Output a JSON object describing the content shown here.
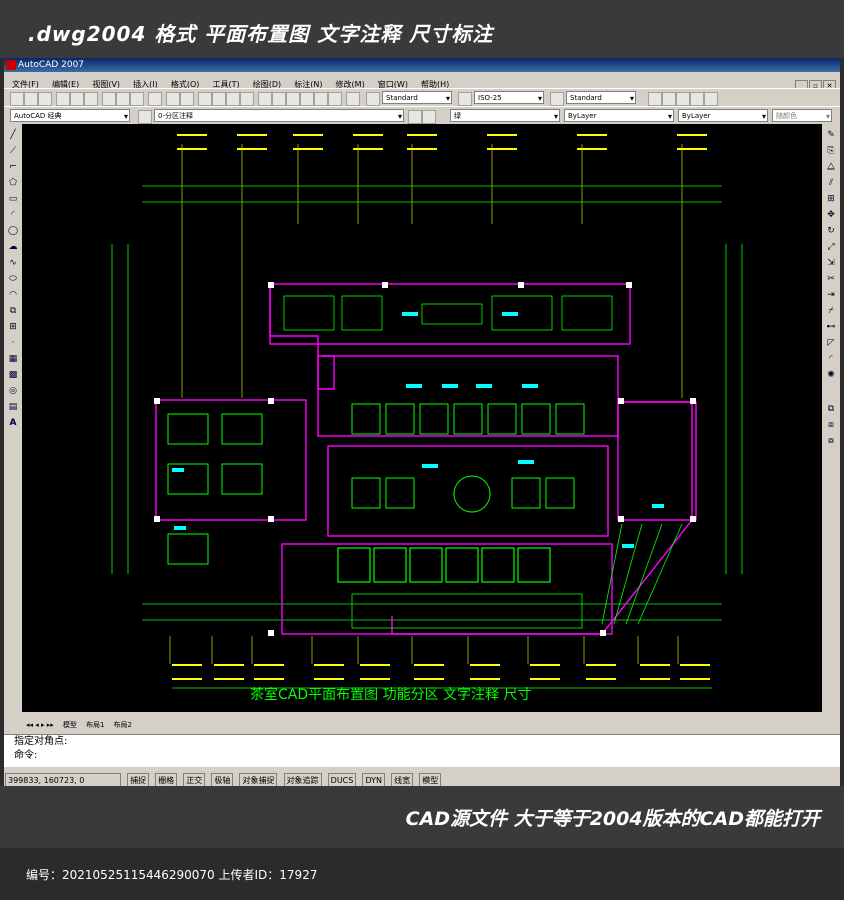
{
  "banner_top": {
    "title": ".dwg2004 格式  平面布置图 文字注释 尺寸标注"
  },
  "app": {
    "title": "AutoCAD 2007",
    "menu": [
      "文件(F)",
      "编辑(E)",
      "视图(V)",
      "插入(I)",
      "格式(O)",
      "工具(T)",
      "绘图(D)",
      "标注(N)",
      "修改(M)",
      "窗口(W)",
      "帮助(H)"
    ],
    "text_style": "Standard",
    "dim_style": "ISO-25",
    "table_style": "Standard",
    "workspace": "AutoCAD 经典",
    "layer": "0-分区注释",
    "color": "绿",
    "linetype": "ByLayer",
    "lineweight": "ByLayer",
    "plotstyle": "随颜色"
  },
  "drawing": {
    "caption": "茶室CAD平面布置图   功能分区   文字注释   尺寸"
  },
  "tabs": {
    "model": "模型",
    "layout1": "布局1",
    "layout2": "布局2"
  },
  "command": {
    "line1": "指定对角点:",
    "line2": "命令:"
  },
  "status": {
    "coords": "399833, 160723, 0",
    "buttons": [
      "捕捉",
      "栅格",
      "正交",
      "极轴",
      "对象捕捉",
      "对象追踪",
      "DUCS",
      "DYN",
      "线宽",
      "模型"
    ]
  },
  "banner_bottom": {
    "title": "CAD源文件  大于等于2004版本的CAD都能打开"
  },
  "footer": {
    "text": "编号：20210525115446290070 上传者ID：17927"
  },
  "colors": {
    "cad_bg": "#000000",
    "wall": "#ff00ff",
    "furniture": "#00ff00",
    "dim": "#ffff00",
    "accent": "#00ffff"
  }
}
